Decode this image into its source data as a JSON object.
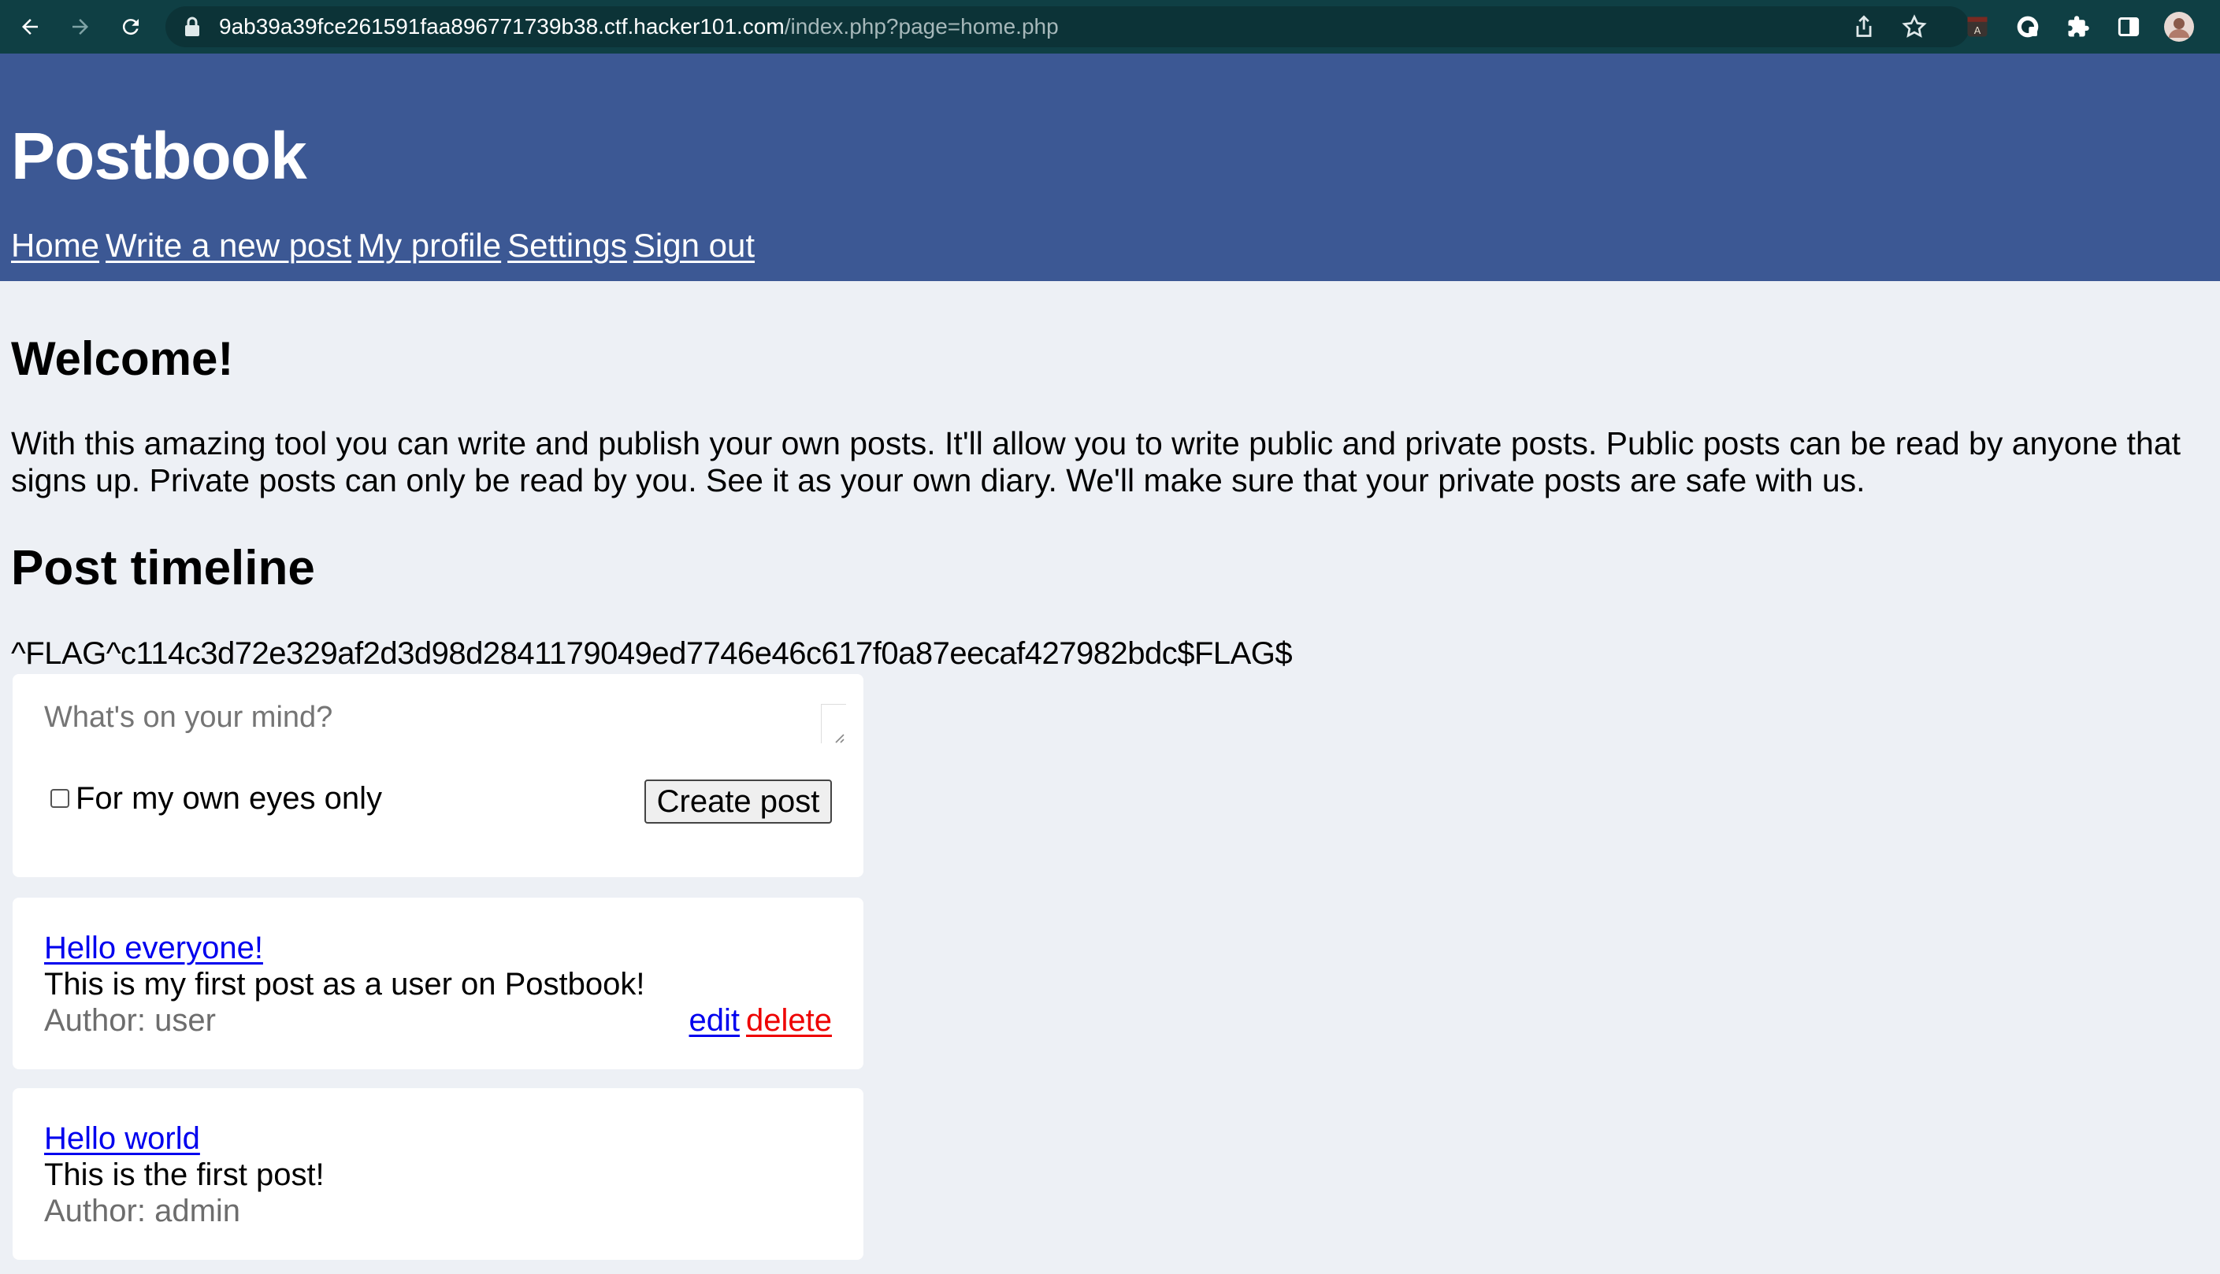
{
  "browser": {
    "url_host": "9ab39a39fce261591faa896771739b38.ctf.hacker101.com",
    "url_path": "/index.php?page=home.php",
    "icons": [
      "back-arrow-icon",
      "forward-arrow-icon",
      "reload-icon",
      "lock-icon",
      "share-icon",
      "star-icon",
      "extension-a-icon",
      "extension-shield-icon",
      "puzzle-icon",
      "side-panel-icon",
      "profile-avatar-icon"
    ],
    "colors": {
      "toolbar": "#0f3f44",
      "omnibox": "#0c3337"
    }
  },
  "header": {
    "title": "Postbook",
    "nav": {
      "home": "Home",
      "write": "Write a new post",
      "profile": "My profile",
      "settings": "Settings",
      "signout": "Sign out"
    },
    "color": "#3c5894"
  },
  "main": {
    "welcome_heading": "Welcome!",
    "intro": "With this amazing tool you can write and publish your own posts. It'll allow you to write public and private posts. Public posts can be read by anyone that signs up. Private posts can only be read by you. See it as your own diary. We'll make sure that your private posts are safe with us.",
    "timeline_heading": "Post timeline",
    "flag": "^FLAG^c114c3d72e329af2d3d98d2841179049ed7746e46c617f0a87eecaf427982bdc$FLAG$"
  },
  "form": {
    "placeholder": "What's on your mind?",
    "value": "",
    "private_label": "For my own eyes only",
    "private_checked": false,
    "submit_label": "Create post"
  },
  "posts": [
    {
      "title": "Hello everyone!",
      "body": "This is my first post as a user on Postbook!",
      "author": "Author: user",
      "edit": "edit",
      "delete": "delete"
    },
    {
      "title": "Hello world",
      "body": "This is the first post!",
      "author": "Author: admin"
    }
  ]
}
